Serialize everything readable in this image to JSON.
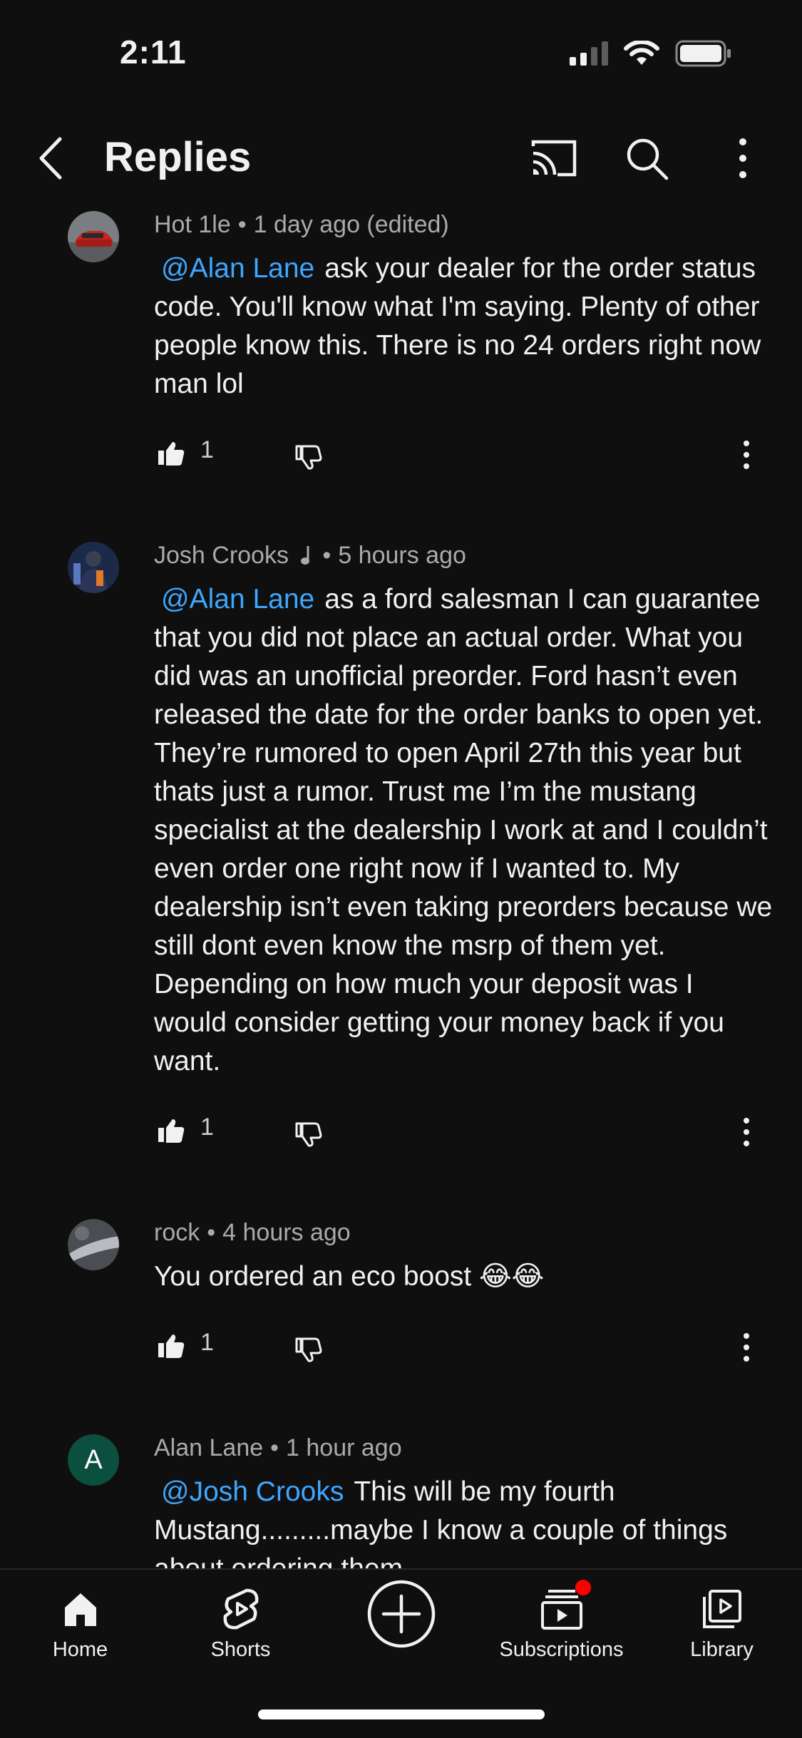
{
  "status_bar": {
    "time": "2:11"
  },
  "header": {
    "title": "Replies"
  },
  "comments": [
    {
      "author": "Hot 1le",
      "time": "1 day ago (edited)",
      "mention": "@Alan Lane",
      "text": "ask your dealer for the order status code. You'll know what I'm saying. Plenty of other people know this. There is no 24 orders right now man lol",
      "likes": "1"
    },
    {
      "author": "Josh Crooks",
      "time": "5 hours ago",
      "mention": "@Alan Lane",
      "text": "as a ford salesman I can guarantee that you did not place an actual order. What you did was an unofficial preorder. Ford hasn’t even released the date for the order banks to open yet. They’re rumored to open April 27th this year but thats just a rumor. Trust me I’m the mustang specialist at the dealership I work at and I couldn’t even order one right now if I wanted to. My dealership isn’t even taking preorders because we still dont even know the msrp of them yet. Depending on how much your deposit was I would consider getting your money back if you want.",
      "likes": "1"
    },
    {
      "author": "rock",
      "time": "4 hours ago",
      "text": "You ordered an eco boost 😂😂",
      "likes": "1"
    },
    {
      "author": "Alan Lane",
      "avatar_letter": "A",
      "time": "1 hour ago",
      "mention": "@Josh Crooks",
      "text": "This will be my fourth Mustang.........maybe I know a couple of things about ordering them"
    }
  ],
  "bottom_nav": [
    {
      "label": "Home",
      "icon": "home-icon"
    },
    {
      "label": "Shorts",
      "icon": "shorts-icon"
    },
    {
      "label": "",
      "icon": "create-icon"
    },
    {
      "label": "Subscriptions",
      "icon": "subscriptions-icon"
    },
    {
      "label": "Library",
      "icon": "library-icon"
    }
  ],
  "colors": {
    "background": "#0f0f0f",
    "mention": "#3ea6ff",
    "notification": "#ff0000",
    "avatar_green": "#0b4f3f"
  }
}
